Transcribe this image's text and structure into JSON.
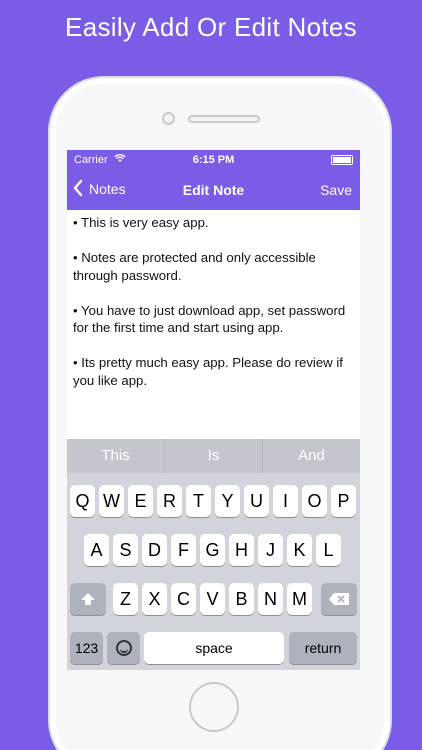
{
  "headline": "Easily Add Or Edit Notes",
  "status": {
    "carrier": "Carrier",
    "time": "6:15 PM"
  },
  "nav": {
    "back": "Notes",
    "title": "Edit Note",
    "save": "Save"
  },
  "note": {
    "paragraphs": [
      "• This is very easy app.",
      "• Notes are protected and only accessible through password.",
      "• You have to just download app, set password for the first time and start using app.",
      "• Its pretty much easy app. Please do review if you like app."
    ]
  },
  "keyboard": {
    "suggestions": [
      "This",
      "Is",
      "And"
    ],
    "row1": [
      "Q",
      "W",
      "E",
      "R",
      "T",
      "Y",
      "U",
      "I",
      "O",
      "P"
    ],
    "row2": [
      "A",
      "S",
      "D",
      "F",
      "G",
      "H",
      "J",
      "K",
      "L"
    ],
    "row3": [
      "Z",
      "X",
      "C",
      "V",
      "B",
      "N",
      "M"
    ],
    "numbers_label": "123",
    "space_label": "space",
    "return_label": "return"
  },
  "colors": {
    "accent": "#7a5ce6",
    "keyboard_bg": "#d1d4da"
  },
  "icons": [
    "wifi-icon",
    "battery-icon",
    "chevron-left-icon",
    "shift-icon",
    "delete-icon",
    "emoji-icon"
  ]
}
